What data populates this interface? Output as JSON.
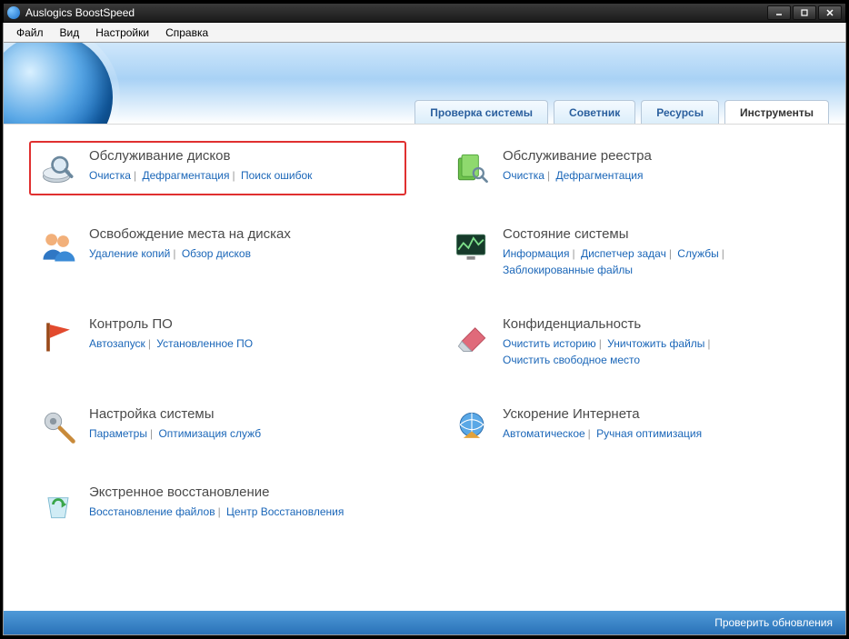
{
  "window": {
    "title": "Auslogics BoostSpeed"
  },
  "menu": {
    "file": "Файл",
    "view": "Вид",
    "settings": "Настройки",
    "help": "Справка"
  },
  "tabs": {
    "check": "Проверка системы",
    "advisor": "Советник",
    "resources": "Ресурсы",
    "tools": "Инструменты"
  },
  "tools": {
    "disk": {
      "title": "Обслуживание дисков",
      "l1": "Очистка",
      "l2": "Дефрагментация",
      "l3": "Поиск ошибок"
    },
    "reg": {
      "title": "Обслуживание реестра",
      "l1": "Очистка",
      "l2": "Дефрагментация"
    },
    "space": {
      "title": "Освобождение места на дисках",
      "l1": "Удаление копий",
      "l2": "Обзор дисков"
    },
    "state": {
      "title": "Состояние системы",
      "l1": "Информация",
      "l2": "Диспетчер задач",
      "l3": "Службы",
      "l4": "Заблокированные файлы"
    },
    "soft": {
      "title": "Контроль ПО",
      "l1": "Автозапуск",
      "l2": "Установленное ПО"
    },
    "priv": {
      "title": "Конфиденциальность",
      "l1": "Очистить историю",
      "l2": "Уничтожить файлы",
      "l3": "Очистить свободное место"
    },
    "tune": {
      "title": "Настройка системы",
      "l1": "Параметры",
      "l2": "Оптимизация служб"
    },
    "net": {
      "title": "Ускорение Интернета",
      "l1": "Автоматическое",
      "l2": "Ручная оптимизация"
    },
    "rescue": {
      "title": "Экстренное восстановление",
      "l1": "Восстановление файлов",
      "l2": "Центр Восстановления"
    }
  },
  "status": {
    "update": "Проверить обновления"
  }
}
